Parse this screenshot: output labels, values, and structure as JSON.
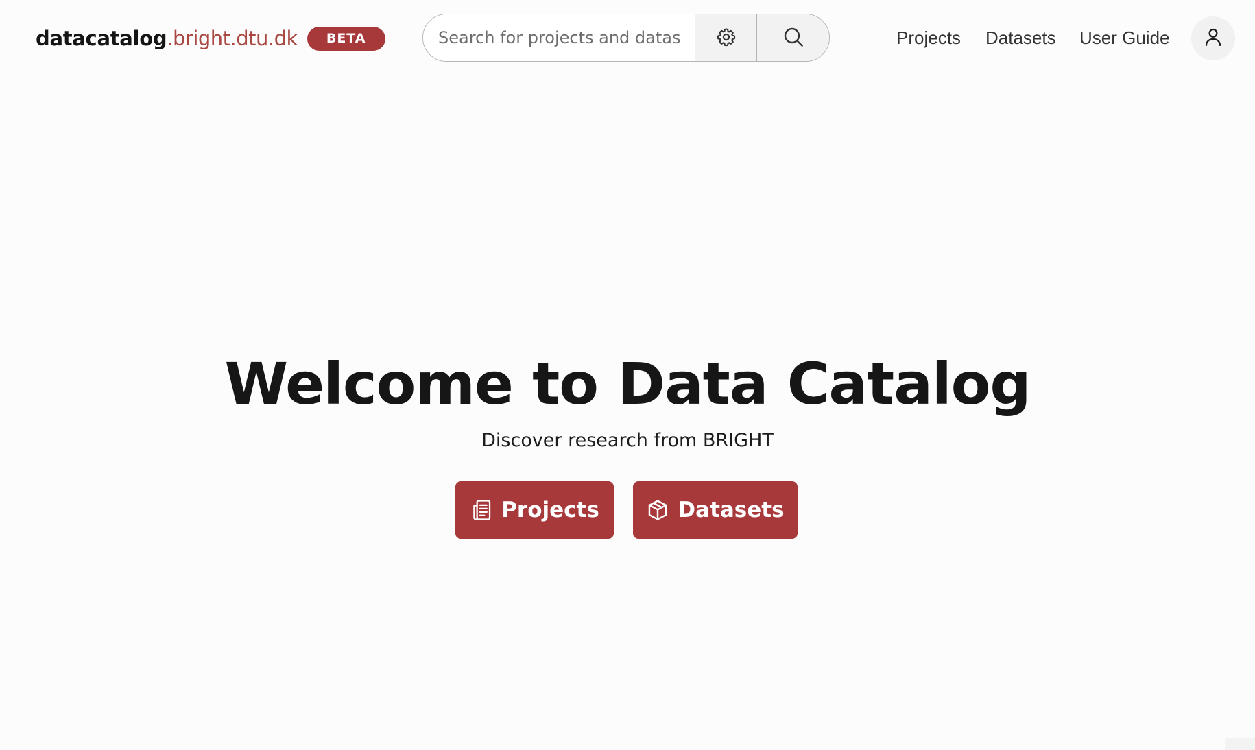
{
  "brand": {
    "name": "datacatalog",
    "domain": ".bright.dtu.dk",
    "badge": "BETA"
  },
  "search": {
    "placeholder": "Search for projects and datasets",
    "value": "",
    "settings_icon": "gear-icon",
    "submit_icon": "search-icon"
  },
  "nav": {
    "items": [
      {
        "label": "Projects"
      },
      {
        "label": "Datasets"
      },
      {
        "label": "User Guide"
      }
    ],
    "user_icon": "user-icon"
  },
  "hero": {
    "title": "Welcome to Data Catalog",
    "subtitle": "Discover research from BRIGHT",
    "buttons": [
      {
        "label": "Projects",
        "icon": "document-stack-icon"
      },
      {
        "label": "Datasets",
        "icon": "package-icon"
      }
    ]
  },
  "colors": {
    "accent": "#a8393a",
    "brand_domain": "#a94842",
    "background": "#fdfcfc"
  }
}
